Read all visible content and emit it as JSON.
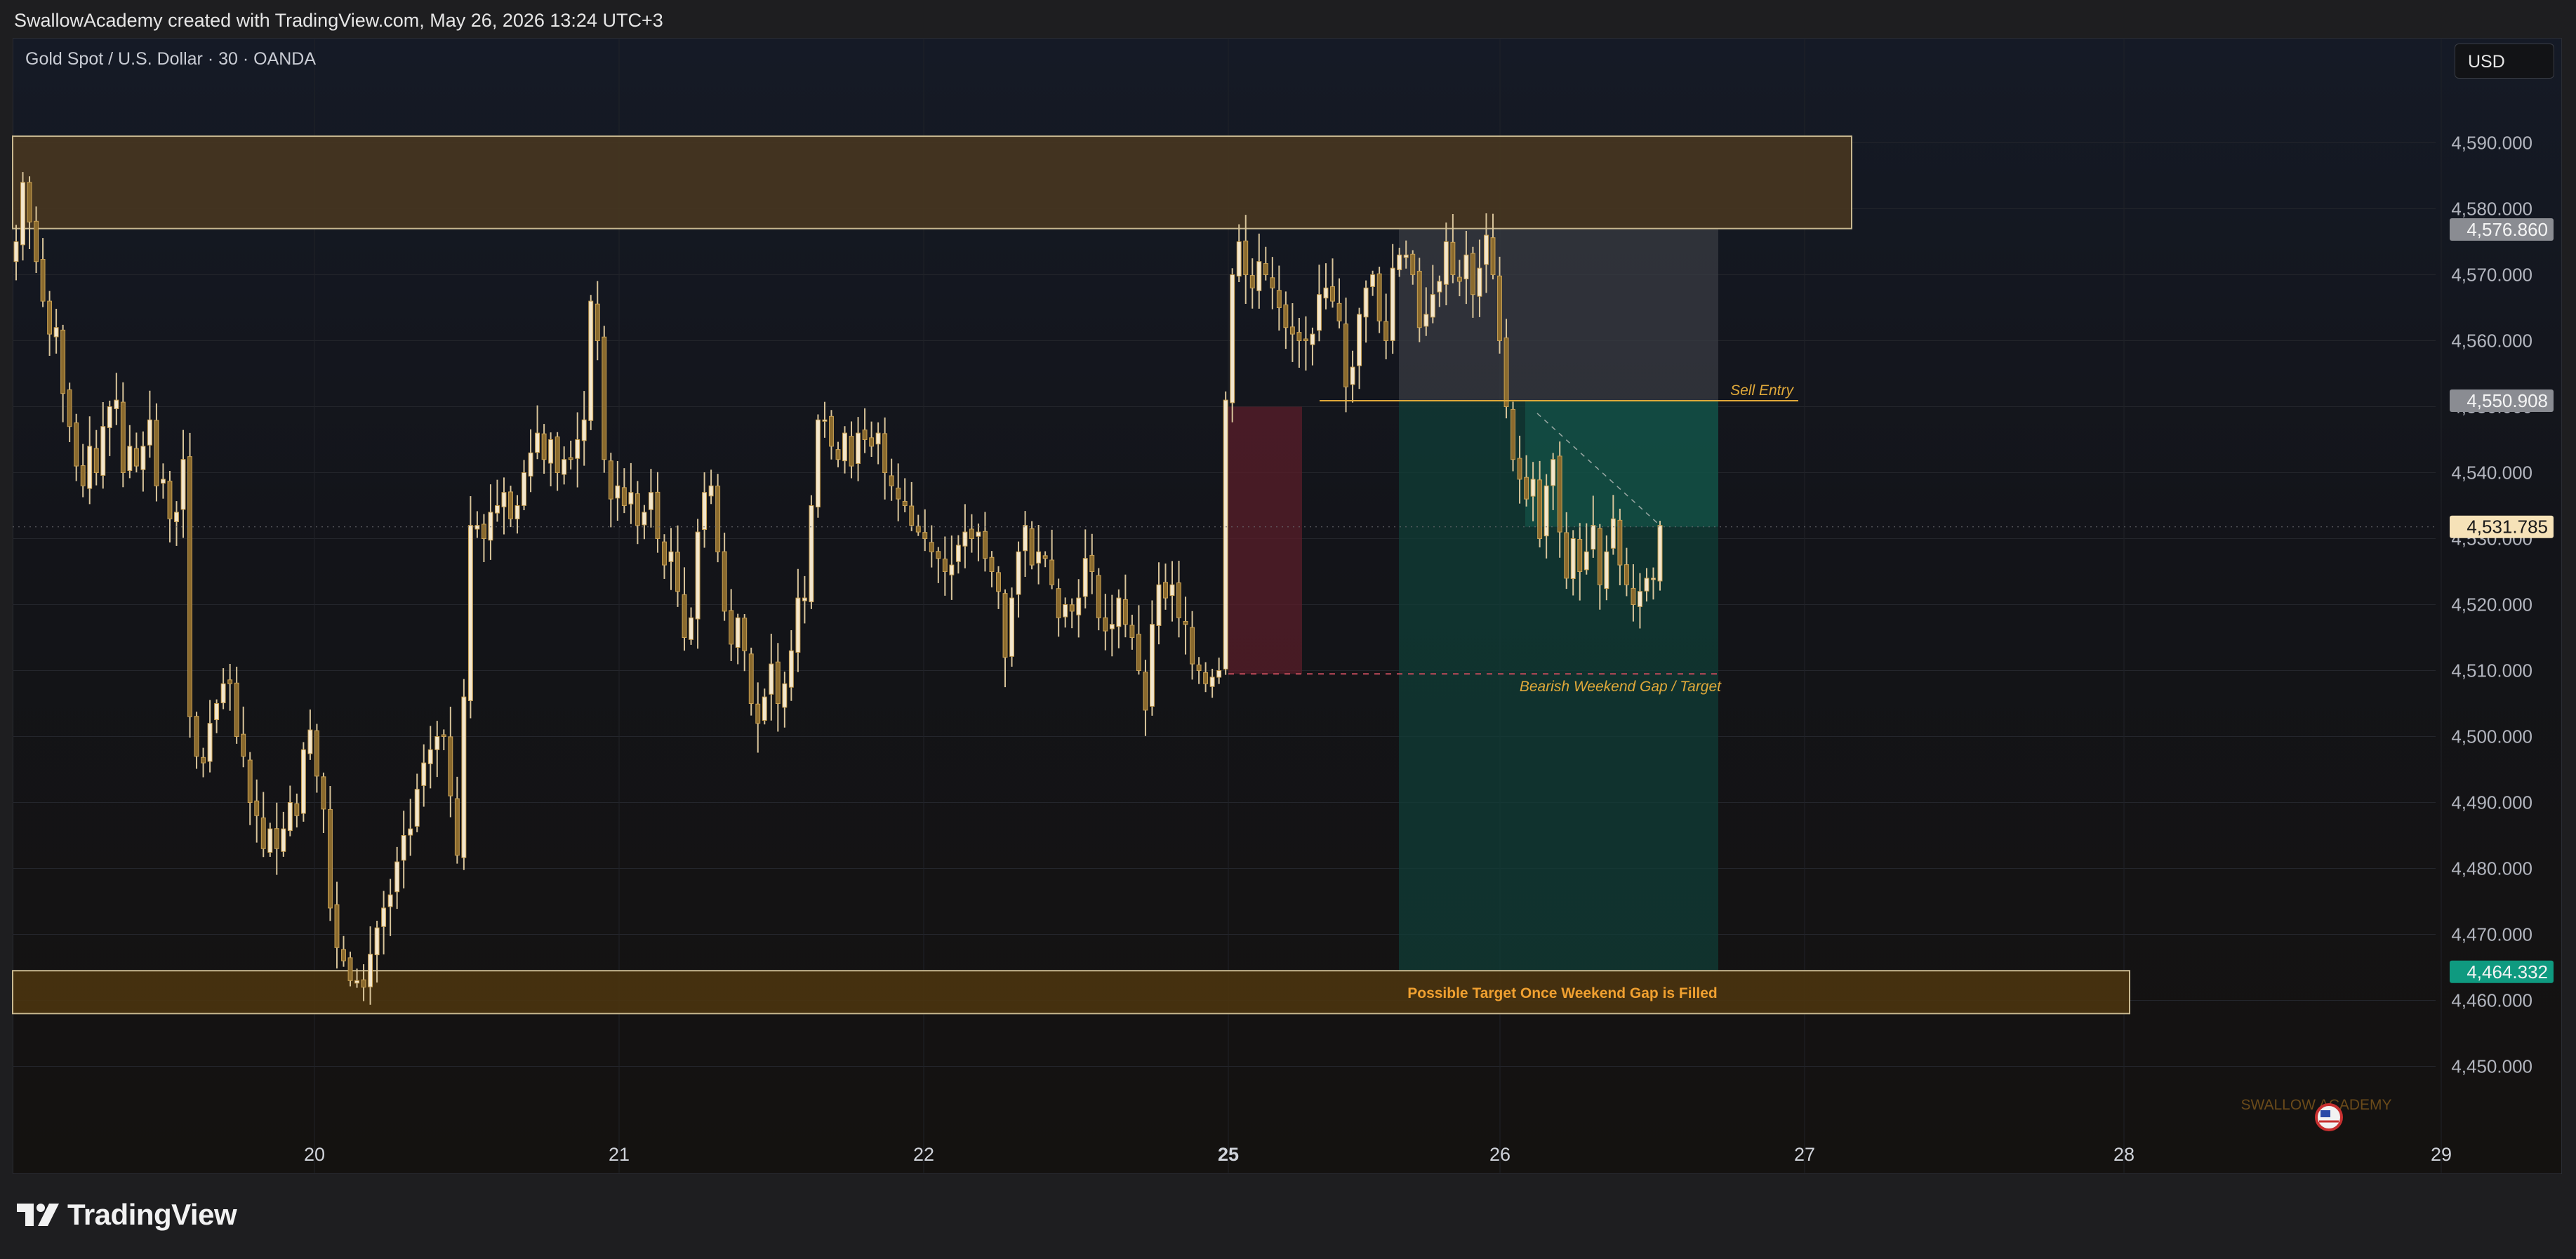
{
  "header": {
    "caption": "SwallowAcademy created with TradingView.com, May 26, 2026 13:24 UTC+3"
  },
  "symbol": {
    "title": "Gold Spot / U.S. Dollar · 30 · OANDA",
    "currency": "USD"
  },
  "footer": {
    "logo_text": "TradingView"
  },
  "colors": {
    "candle_body": "#f3e6cc",
    "candle_outline": "#c9a052",
    "supply_zone": "#4a3820",
    "demand_zone": "#4a3410",
    "short_stop": "#3b3d44",
    "short_target": "#103e37",
    "gap_fill": "#5a1e2a",
    "annotation": "#e0a93a",
    "accent_green": "#0f9a80"
  },
  "chart_data": {
    "type": "candlestick",
    "instrument": "Gold Spot / U.S. Dollar",
    "timeframe": "30",
    "source": "OANDA",
    "x_ticks": [
      "20",
      "21",
      "22",
      "25",
      "26",
      "27",
      "28",
      "29"
    ],
    "y_ticks": [
      "4,590.000",
      "4,580.000",
      "4,570.000",
      "4,560.000",
      "4,550.000",
      "4,540.000",
      "4,530.000",
      "4,520.000",
      "4,510.000",
      "4,500.000",
      "4,490.000",
      "4,480.000",
      "4,470.000",
      "4,460.000",
      "4,450.000"
    ],
    "y_tick_values": [
      4590,
      4580,
      4570,
      4560,
      4550,
      4540,
      4530,
      4520,
      4510,
      4500,
      4490,
      4480,
      4470,
      4460,
      4450
    ],
    "ylim": [
      4441,
      4600
    ],
    "price_labels": [
      {
        "text": "4,576.860",
        "value": 4576.86,
        "style": "grey"
      },
      {
        "text": "4,550.908",
        "value": 4550.908,
        "style": "grey"
      },
      {
        "text": "4,531.785",
        "value": 4531.785,
        "style": "current"
      },
      {
        "text": "4,464.332",
        "value": 4464.332,
        "style": "green"
      }
    ],
    "annotations": {
      "sell_entry": "Sell Entry",
      "gap_target": "Bearish Weekend Gap / Target",
      "possible_target": "Possible Target Once Weekend Gap is Filled"
    },
    "zones": {
      "supply_zone": {
        "price_top": 4591,
        "price_bottom": 4577
      },
      "demand_zone": {
        "price_top": 4464.5,
        "price_bottom": 4458
      },
      "short_position": {
        "entry": 4550.9,
        "stop": 4576.86,
        "target": 4464.33
      },
      "weekend_gap": {
        "price_top": 4550,
        "price_bottom": 4509.5
      }
    },
    "watermark": "SWALLOW ACADEMY",
    "closes": [
      4575,
      4584,
      4578,
      4572,
      4566,
      4561,
      4562,
      4552,
      4547,
      4541,
      4538,
      4544,
      4540,
      4547,
      4550,
      4551,
      4540,
      4544,
      4541,
      4544,
      4548,
      4538,
      4539,
      4533,
      4534,
      4542,
      4503,
      4497,
      4496,
      4502,
      4505,
      4508,
      4508,
      4500,
      4497,
      4490,
      4488,
      4483,
      4486,
      4483,
      4486,
      4490,
      4488,
      4498,
      4501,
      4494,
      4489,
      4474,
      4468,
      4466,
      4463,
      4463,
      4462,
      4467,
      4471,
      4474,
      4476,
      4481,
      4485,
      4486,
      4492,
      4496,
      4498,
      4500,
      4500,
      4491,
      4482,
      4506,
      4532,
      4532,
      4530,
      4534,
      4535,
      4537,
      4533,
      4535,
      4540,
      4543,
      4546,
      4542,
      4545,
      4540,
      4542,
      4542,
      4545,
      4548,
      4566,
      4560,
      4542,
      4536,
      4538,
      4535,
      4537,
      4532,
      4534,
      4537,
      4530,
      4526,
      4528,
      4522,
      4515,
      4518,
      4531,
      4537,
      4538,
      4528,
      4519,
      4514,
      4518,
      4513,
      4505,
      4502,
      4506,
      4511,
      4505,
      4508,
      4513,
      4521,
      4521,
      4535,
      4548,
      4548,
      4544,
      4542,
      4546,
      4541,
      4546,
      4545,
      4544,
      4546,
      4540,
      4538,
      4536,
      4535,
      4532,
      4531,
      4530,
      4528,
      4527,
      4525,
      4526,
      4529,
      4531,
      4530,
      4531,
      4527,
      4525,
      4522,
      4512,
      4521,
      4528,
      4532,
      4526,
      4528,
      4527,
      4523,
      4518,
      4520,
      4519,
      4521,
      4527,
      4525,
      4518,
      4516,
      4517,
      4521,
      4517,
      4515,
      4510,
      4504,
      4517,
      4523,
      4521,
      4523,
      4518,
      4517,
      4511,
      4510,
      4508,
      4509,
      4510,
      4551,
      4570,
      4575,
      4570,
      4568,
      4572,
      4570,
      4568,
      4565,
      4562,
      4561,
      4560,
      4560,
      4561,
      4567,
      4568,
      4566,
      4563,
      4553,
      4556,
      4564,
      4568,
      4570,
      4563,
      4560,
      4571,
      4573,
      4573,
      4570,
      4562,
      4564,
      4567,
      4569,
      4575,
      4570,
      4569,
      4573,
      4567,
      4571,
      4576,
      4570,
      4560,
      4550,
      4542,
      4539,
      4536,
      4539,
      4530,
      4538,
      4542,
      4531,
      4524,
      4530,
      4525,
      4528,
      4532,
      4523,
      4528,
      4533,
      4526,
      4523,
      4520,
      4522,
      4524,
      4524,
      4532
    ],
    "last_price": 4531.785
  }
}
